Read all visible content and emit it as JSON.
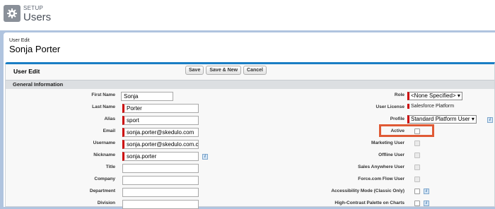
{
  "header": {
    "section": "SETUP",
    "title": "Users",
    "icon": "gear-icon"
  },
  "record": {
    "label": "User Edit",
    "name": "Sonja Porter"
  },
  "panel": {
    "title": "User Edit",
    "buttons": {
      "save": "Save",
      "save_new": "Save & New",
      "cancel": "Cancel"
    },
    "section": "General Information"
  },
  "left_fields": {
    "first_name": {
      "label": "First Name",
      "value": "Sonja"
    },
    "last_name": {
      "label": "Last Name",
      "value": "Porter"
    },
    "alias": {
      "label": "Alias",
      "value": "sport"
    },
    "email": {
      "label": "Email",
      "value": "sonja.porter@skedulo.com"
    },
    "username": {
      "label": "Username",
      "value": "sonja.porter@skedulo.com.c"
    },
    "nickname": {
      "label": "Nickname",
      "value": "sonja.porter"
    },
    "title": {
      "label": "Title",
      "value": ""
    },
    "company": {
      "label": "Company",
      "value": ""
    },
    "department": {
      "label": "Department",
      "value": ""
    },
    "division": {
      "label": "Division",
      "value": ""
    }
  },
  "right_fields": {
    "role": {
      "label": "Role",
      "value": "<None Specified>"
    },
    "user_license": {
      "label": "User License",
      "value": "Salesforce Platform"
    },
    "profile": {
      "label": "Profile",
      "value": "Standard Platform User"
    },
    "active": {
      "label": "Active"
    },
    "marketing_user": {
      "label": "Marketing User"
    },
    "offline_user": {
      "label": "Offline User"
    },
    "sales_anywhere": {
      "label": "Sales Anywhere User"
    },
    "flow_user": {
      "label": "Force.com Flow User"
    },
    "accessibility": {
      "label": "Accessibility Mode (Classic Only)"
    },
    "high_contrast": {
      "label": "High-Contrast Palette on Charts"
    }
  },
  "info_glyph": "i",
  "colors": {
    "accent": "#1a7ec4",
    "required": "#cc0000",
    "highlight": "#e05a35",
    "background": "#b0c4df"
  }
}
